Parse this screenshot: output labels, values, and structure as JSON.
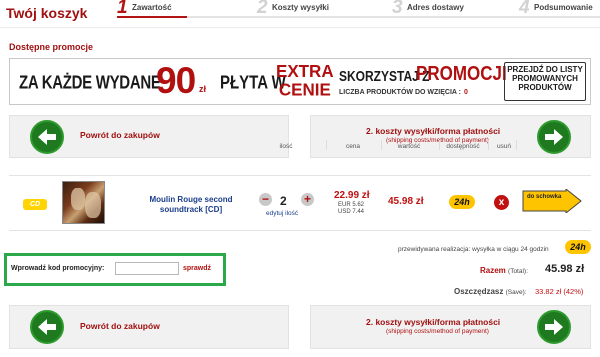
{
  "header": {
    "title": "Twój koszyk",
    "steps": [
      {
        "num": "1",
        "label": "Zawartość"
      },
      {
        "num": "2",
        "label": "Koszty wysyłki"
      },
      {
        "num": "3",
        "label": "Adres dostawy"
      },
      {
        "num": "4",
        "label": "Podsumowanie"
      }
    ]
  },
  "promotions": {
    "heading": "Dostępne promocje",
    "banner": {
      "text1": "ZA KAŻDE WYDANE",
      "amount": "90",
      "currency": "zł",
      "text2": "PŁYTA W",
      "extra_line1": "EXTRA",
      "extra_line2": "CENIE",
      "use_text": "SKORZYSTAJ Z",
      "promo_word": "PROMOCJI",
      "count_label": "LICZBA PRODUKTÓW DO WZIĘCIA :",
      "count_value": "0",
      "list_button": "PRZEJDŹ DO LISTY PROMOWANYCH PRODUKTÓW"
    }
  },
  "nav": {
    "back_label": "Powrót do zakupów",
    "next_label": "2. koszty wysyłki/forma płatności",
    "next_sub": "(shipping costs/method of payment)"
  },
  "table": {
    "headers": {
      "qty": "ilość",
      "price": "cena",
      "value": "wartość",
      "availability": "dostępność",
      "remove": "usuń"
    },
    "item": {
      "format": "CD",
      "name": "Moulin Rouge second soundtrack [CD]",
      "quantity": "2",
      "minus": "−",
      "plus": "+",
      "edit_qty": "edytuj ilość",
      "price": "22.99 zł",
      "price_eur": "EUR 5.62",
      "price_usd": "USD 7.44",
      "value": "45.98 zł",
      "availability": "24h",
      "remove_icon": "x",
      "wishlist": "do schowka"
    }
  },
  "summary": {
    "realization_label": "przewidywana realizacja:",
    "realization_value": "wysyłka w ciągu 24 godzin",
    "realization_badge": "24h",
    "total_label": "Razem",
    "total_sub": "(Total):",
    "total_value": "45.98 zł",
    "save_label": "Oszczędzasz",
    "save_sub": "(Save):",
    "save_value": "33.82 zł (42%)"
  },
  "coupon": {
    "label": "Wprowadź kod promocyjny:",
    "value": "",
    "button": "sprawdź"
  },
  "colors": {
    "accent": "#b01010",
    "green": "#1f7a1f",
    "badge": "#ffc400",
    "coupon_border": "#2aa84a"
  }
}
